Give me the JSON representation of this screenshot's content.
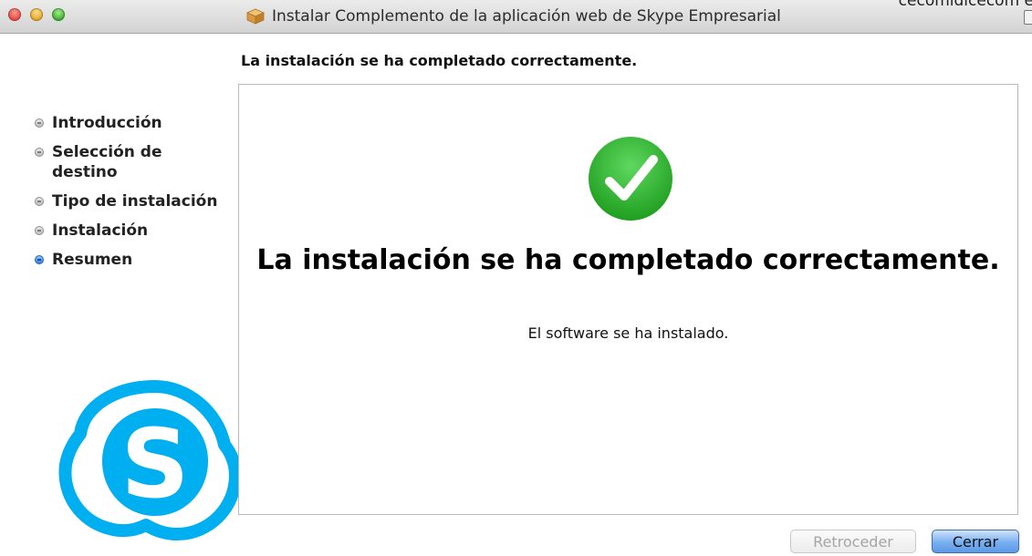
{
  "window": {
    "title": "Instalar Complemento de la aplicación web de Skype Empresarial",
    "corner_text": "cecomidicecom e"
  },
  "header": {
    "step_title": "La instalación se ha completado correctamente."
  },
  "sidebar": {
    "steps": [
      {
        "label": "Introducción",
        "active": false
      },
      {
        "label": "Selección de destino",
        "active": false
      },
      {
        "label": "Tipo de instalación",
        "active": false
      },
      {
        "label": "Instalación",
        "active": false
      },
      {
        "label": "Resumen",
        "active": true
      }
    ]
  },
  "main": {
    "success_title": "La instalación se ha completado correctamente.",
    "success_subtitle": "El software se ha instalado."
  },
  "buttons": {
    "back_label": "Retroceder",
    "close_label": "Cerrar"
  },
  "colors": {
    "check_green": "#2fb52f",
    "skype_blue": "#00aff0",
    "active_step_blue": "#2f7fe0"
  }
}
